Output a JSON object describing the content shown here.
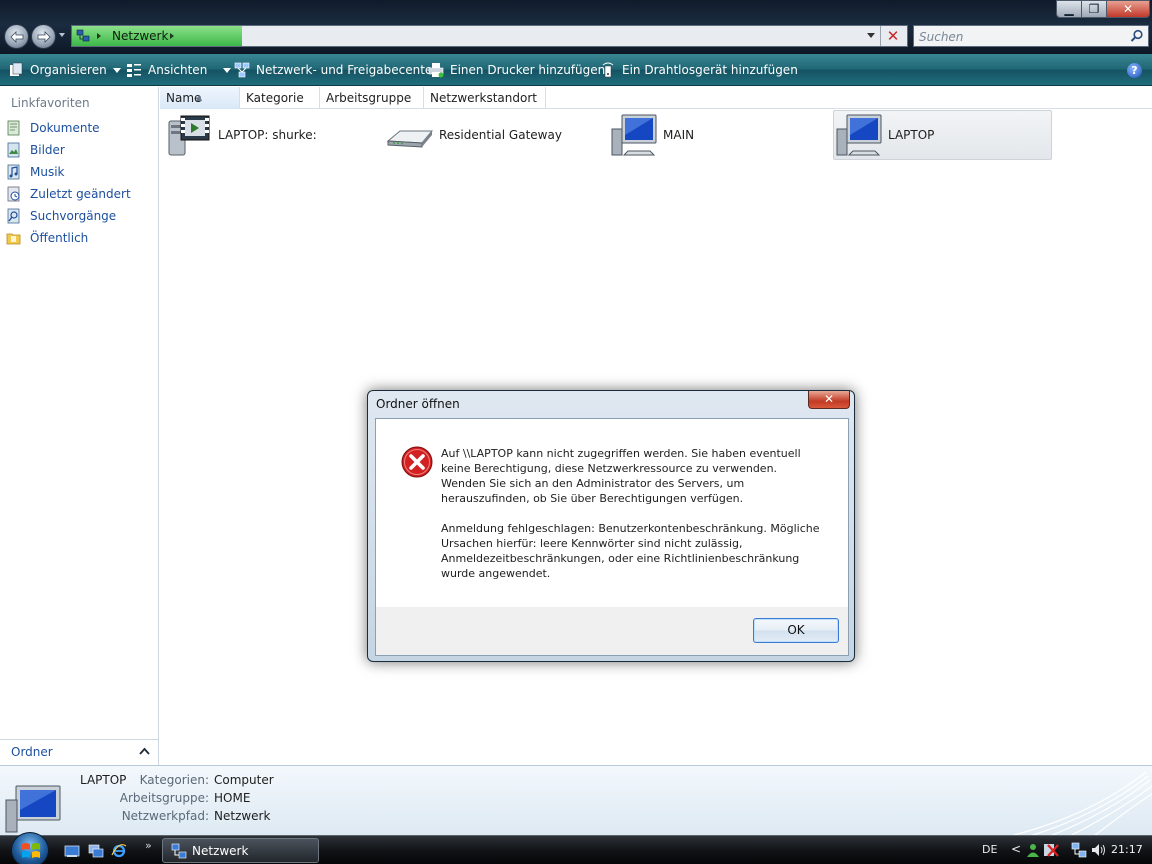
{
  "window": {
    "breadcrumb": "Netzwerk",
    "search_placeholder": "Suchen",
    "min_label": "▁",
    "max_label": "❐",
    "close_label": "✕"
  },
  "toolbar": {
    "organize": "Organisieren",
    "views": "Ansichten",
    "network_center": "Netzwerk- und Freigabecenter",
    "add_printer": "Einen Drucker hinzufügen",
    "add_wireless": "Ein Drahtlosgerät hinzufügen",
    "help": "?"
  },
  "navpane": {
    "title": "Linkfavoriten",
    "items": [
      {
        "label": "Dokumente",
        "icon": "documents-icon"
      },
      {
        "label": "Bilder",
        "icon": "pictures-icon"
      },
      {
        "label": "Musik",
        "icon": "music-icon"
      },
      {
        "label": "Zuletzt geändert",
        "icon": "recent-icon"
      },
      {
        "label": "Suchvorgänge",
        "icon": "searches-icon"
      },
      {
        "label": "Öffentlich",
        "icon": "public-folder-icon"
      }
    ],
    "folders_label": "Ordner"
  },
  "columns": [
    "Name",
    "Kategorie",
    "Arbeitsgruppe",
    "Netzwerkstandort"
  ],
  "items": [
    {
      "label": "LAPTOP: shurke:",
      "icon": "media-server-icon"
    },
    {
      "label": "Residential Gateway",
      "icon": "router-icon"
    },
    {
      "label": "MAIN",
      "icon": "computer-icon"
    },
    {
      "label": "LAPTOP",
      "icon": "computer-icon",
      "selected": true
    }
  ],
  "details": {
    "name": "LAPTOP",
    "rows": [
      {
        "label": "Kategorien:",
        "value": "Computer"
      },
      {
        "label": "Arbeitsgruppe:",
        "value": "HOME"
      },
      {
        "label": "Netzwerkpfad:",
        "value": "Netzwerk"
      }
    ]
  },
  "dialog": {
    "title": "Ordner öffnen",
    "close_label": "✕",
    "message1": "Auf \\\\LAPTOP kann nicht zugegriffen werden. Sie haben eventuell keine Berechtigung, diese Netzwerkressource zu verwenden. Wenden Sie sich an den Administrator des Servers, um herauszufinden, ob Sie über Berechtigungen verfügen.",
    "message2": "Anmeldung fehlgeschlagen: Benutzerkontenbeschränkung. Mögliche Ursachen hierfür: leere Kennwörter sind nicht zulässig, Anmeldezeitbeschränkungen, oder eine Richtlinienbeschränkung wurde angewendet.",
    "ok_label": "OK"
  },
  "taskbar": {
    "task_label": "Netzwerk",
    "more": "»",
    "language": "DE",
    "tray_arrow": "<",
    "clock": "21:17"
  },
  "colors": {
    "accent": "#1b4f9e",
    "cmdbar": "#1f6674",
    "progress": "#3bb848",
    "error": "#c62828"
  }
}
